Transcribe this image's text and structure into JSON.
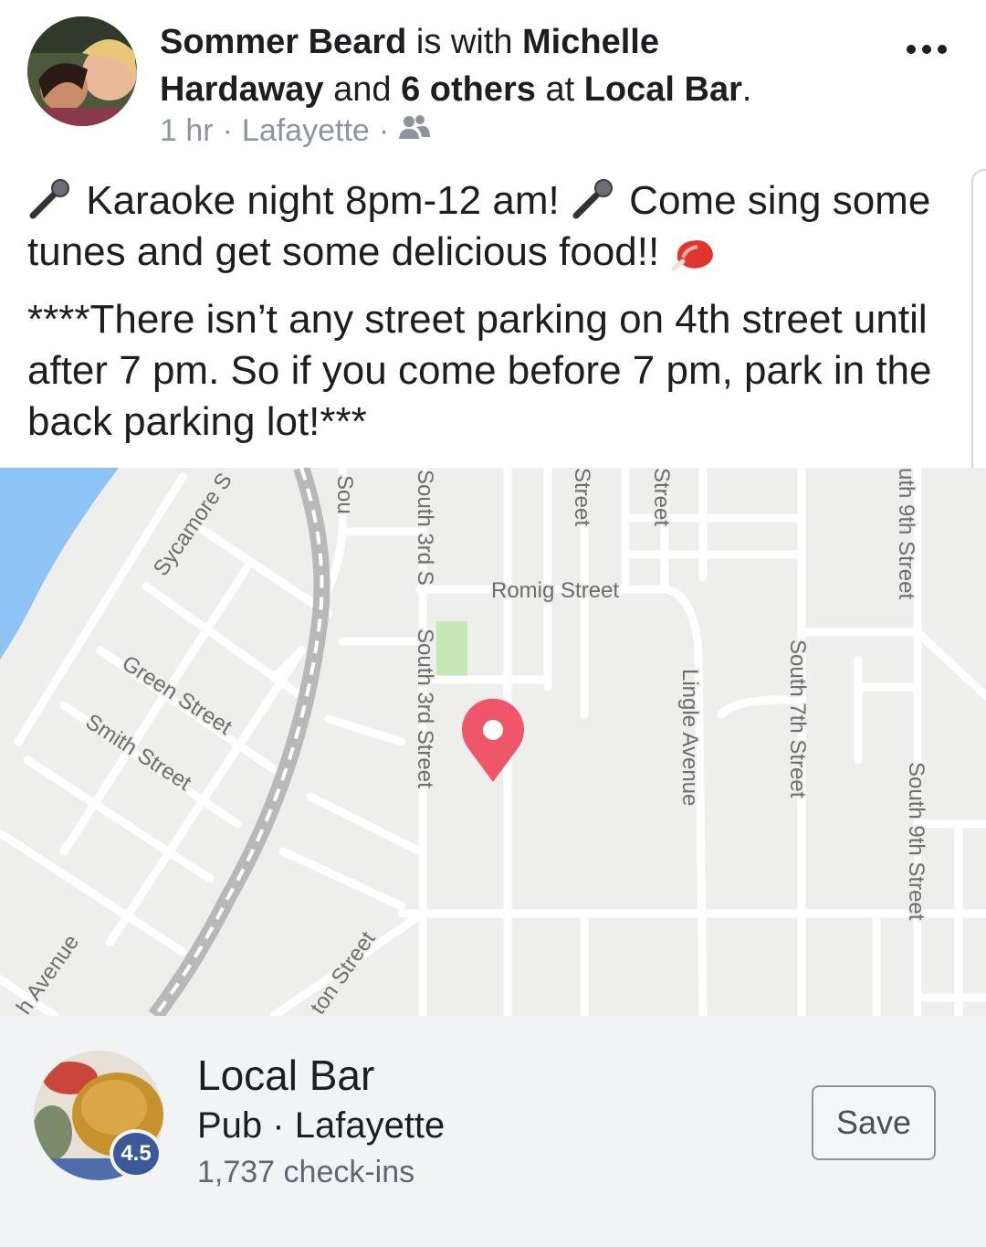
{
  "post": {
    "author": "Sommer Beard",
    "with_text": " is with ",
    "tagged_person_line1": "Michelle",
    "tagged_person_line2": "Hardaway",
    "and_text": " and ",
    "others": "6 others",
    "at_text": " at ",
    "place": "Local Bar",
    "period": ".",
    "time": "1 hr",
    "separator": " · ",
    "location": "Lafayette",
    "audience_icon": "friends-icon",
    "more_icon": "more-options-icon",
    "paragraph1_part1": " Karaoke night 8pm-12 am! ",
    "paragraph1_part2": " Come sing some tunes and get some delicious food!! ",
    "paragraph2": "****There isn’t any street parking on 4th street until after 7 pm. So if you come before 7 pm, park in the back parking lot!***"
  },
  "map": {
    "pin_color": "#f0566a",
    "water_color": "#8ec3f5",
    "labels": {
      "sycamore": "Sycamore S",
      "sou": "Sou",
      "south3rd_top": "South 3rd S",
      "street_a": "Street",
      "street_b": "Street",
      "romig": "Romig Street",
      "green": "Green Street",
      "smith": "Smith Street",
      "south3rd": "South 3rd Street",
      "lingle": "Lingle Avenue",
      "south7th": "South 7th Street",
      "south9th_top": "uth 9th Street",
      "south9th": "South 9th Street",
      "avenue": "h Avenue",
      "ton_street": "ton Street"
    }
  },
  "place_card": {
    "name": "Local Bar",
    "category": "Pub · Lafayette",
    "checkins": "1,737 check-ins",
    "rating": "4.5",
    "save_label": "Save",
    "rating_color": "#3b5998"
  }
}
